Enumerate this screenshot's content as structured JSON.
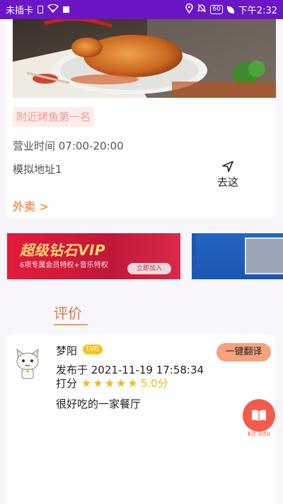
{
  "status_bar": {
    "carrier": "未插卡",
    "battery": "60",
    "time": "下午2:32"
  },
  "shop": {
    "rank_badge": "附近烤鱼第一名",
    "hours": "营业时间 07:00-20:00",
    "address": "模拟地址1",
    "navigate_label": "去这",
    "delivery_link": "外卖 >"
  },
  "banners": {
    "vip_title": "超级钻石VIP",
    "vip_subtitle": "6项专属会员特权+音乐特权",
    "vip_join": "立即加入"
  },
  "reviews": {
    "section_title": "评价",
    "items": [
      {
        "username": "梦阳",
        "level": "LV0",
        "translate_label": "一键翻译",
        "posted": "发布于 2021-11-19 17:58:34",
        "rating_label": "打分",
        "stars": 5,
        "score": "5.0分",
        "comment": "很好吃的一家餐厅"
      }
    ]
  },
  "kit_info": {
    "label": "Kit Info"
  },
  "colors": {
    "status_bar": "#6a16c6",
    "accent_orange": "#f09a5a",
    "star": "#f5b721",
    "translate_button": "#f7a17d",
    "kit_info": "#f35b4b"
  },
  "icons": [
    "sim-icon",
    "wifi-icon",
    "location-icon",
    "mute-icon",
    "battery-icon",
    "navigation-arrow-icon",
    "star-icon",
    "book-icon"
  ]
}
